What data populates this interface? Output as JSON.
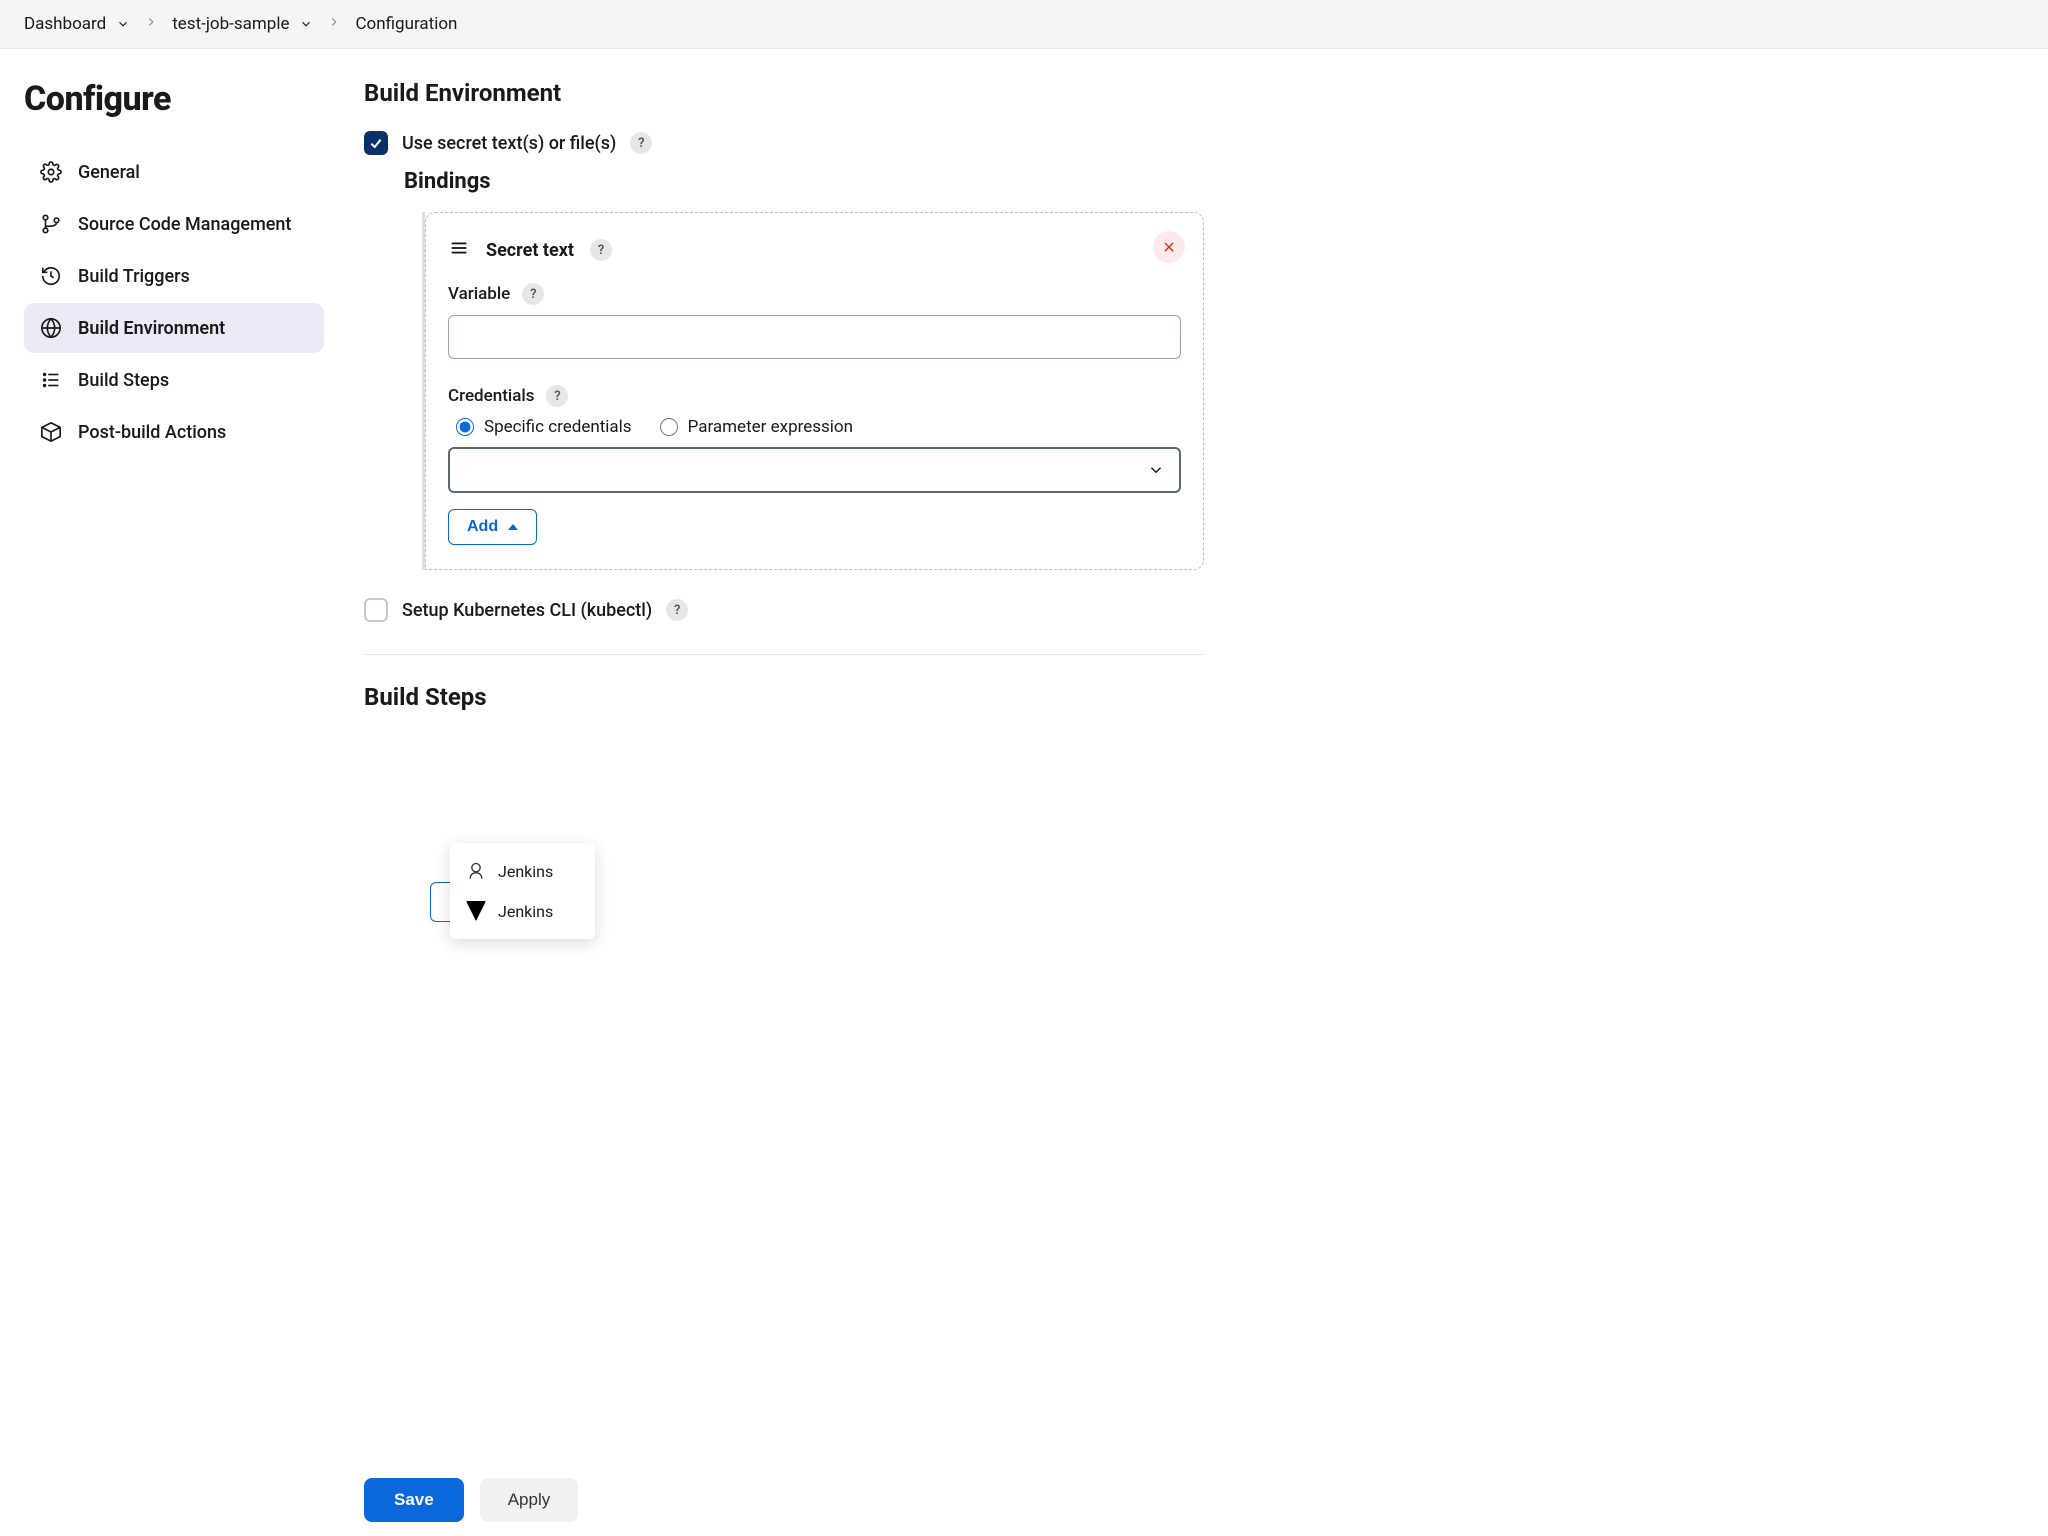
{
  "breadcrumbs": {
    "dashboard": "Dashboard",
    "job": "test-job-sample",
    "page": "Configuration"
  },
  "sidebar": {
    "title": "Configure",
    "items": [
      {
        "label": "General"
      },
      {
        "label": "Source Code Management"
      },
      {
        "label": "Build Triggers"
      },
      {
        "label": "Build Environment"
      },
      {
        "label": "Build Steps"
      },
      {
        "label": "Post-build Actions"
      }
    ]
  },
  "main": {
    "section_title": "Build Environment",
    "use_secret_label": "Use secret text(s) or file(s)",
    "bindings_heading": "Bindings",
    "binding_type": "Secret text",
    "variable_label": "Variable",
    "variable_value": "",
    "credentials_label": "Credentials",
    "radio_specific": "Specific credentials",
    "radio_param": "Parameter expression",
    "add_label": "Add",
    "dropdown_item_1": "Jenkins",
    "dropdown_item_2": "Jenkins",
    "setup_k8s_label": "Setup Kubernetes CLI (kubectl)",
    "build_steps_title": "Build Steps"
  },
  "actions": {
    "save": "Save",
    "apply": "Apply"
  },
  "help": "?"
}
